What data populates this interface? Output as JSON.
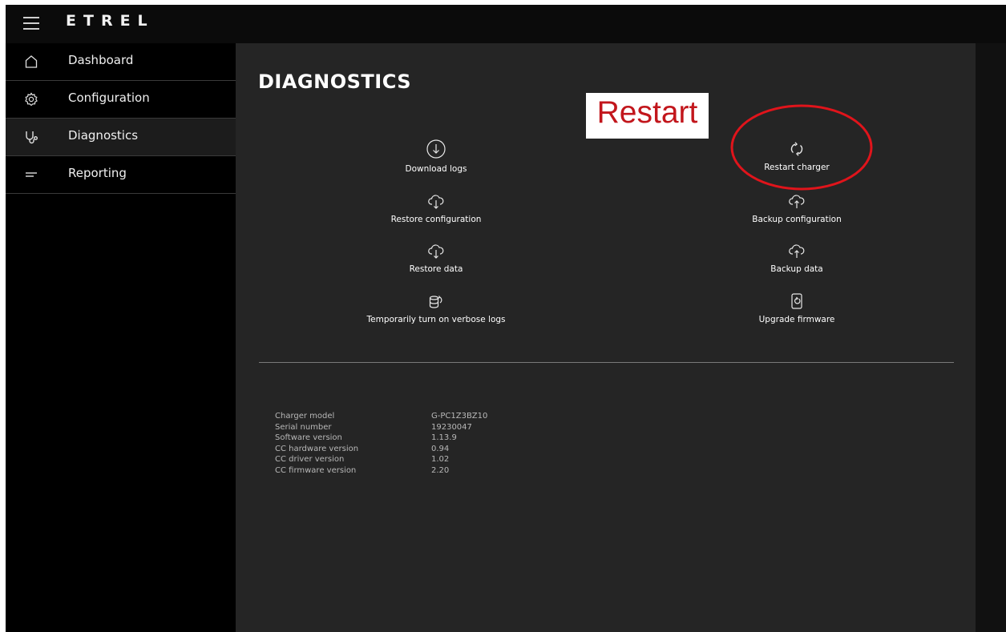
{
  "app": {
    "logo": "ETREL"
  },
  "sidebar": {
    "items": [
      {
        "label": "Dashboard",
        "icon": "home-icon"
      },
      {
        "label": "Configuration",
        "icon": "gear-icon"
      },
      {
        "label": "Diagnostics",
        "icon": "stethoscope-icon",
        "active": true
      },
      {
        "label": "Reporting",
        "icon": "report-lines-icon"
      }
    ]
  },
  "main": {
    "title": "DIAGNOSTICS",
    "actions": {
      "download_logs": "Download logs",
      "restart_charger": "Restart charger",
      "restore_configuration": "Restore configuration",
      "backup_configuration": "Backup configuration",
      "restore_data": "Restore data",
      "backup_data": "Backup data",
      "verbose_logs": "Temporarily turn on verbose logs",
      "upgrade_firmware": "Upgrade firmware"
    },
    "info": [
      {
        "key": "Charger model",
        "value": "G-PC1Z3BZ10"
      },
      {
        "key": "Serial number",
        "value": "19230047"
      },
      {
        "key": "Software version",
        "value": "1.13.9"
      },
      {
        "key": "CC hardware version",
        "value": "0.94"
      },
      {
        "key": "CC driver version",
        "value": "1.02"
      },
      {
        "key": "CC firmware version",
        "value": "2.20"
      }
    ]
  },
  "annotation": {
    "text": "Restart",
    "color": "#c2161c"
  },
  "colors": {
    "background": "#252525",
    "sidebar": "#000000",
    "active_item": "#1c1c1c"
  }
}
